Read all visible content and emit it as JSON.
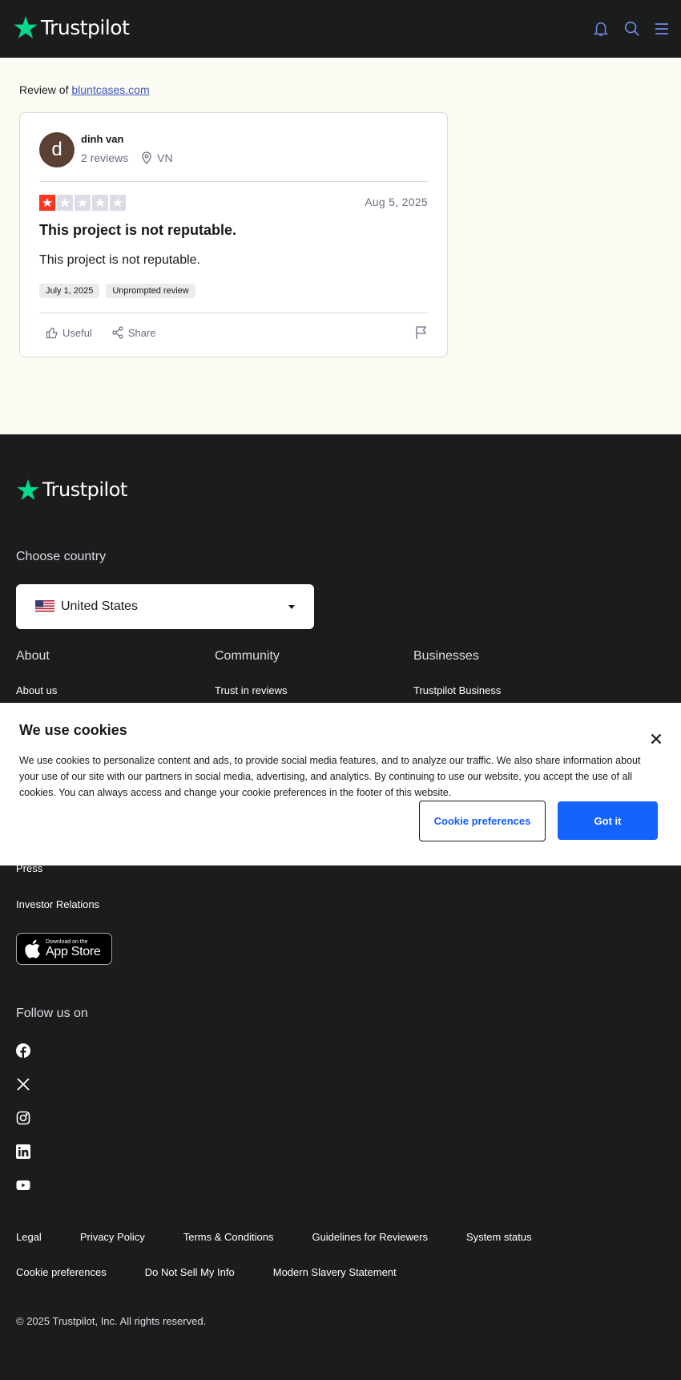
{
  "header": {
    "brand": "Trustpilot",
    "icons": [
      "bell-icon",
      "search-icon",
      "menu-icon"
    ]
  },
  "review_of": {
    "prefix": "Review of",
    "domain": "bluntcases.com"
  },
  "review": {
    "avatar_initial": "d",
    "author": "dinh van",
    "review_count": "2 reviews",
    "location": "VN",
    "rating": 1,
    "max_rating": 5,
    "date": "Aug 5, 2025",
    "title": "This project is not reputable.",
    "body": "This project is not reputable.",
    "experience_date": "July 1, 2025",
    "tag": "Unprompted review",
    "useful_label": "Useful",
    "share_label": "Share"
  },
  "footer": {
    "brand": "Trustpilot",
    "choose_country": "Choose country",
    "country": "United States",
    "columns": [
      {
        "heading": "About",
        "first_link": "About us"
      },
      {
        "heading": "Community",
        "first_link": "Trust in reviews"
      },
      {
        "heading": "Businesses",
        "first_link": "Trustpilot Business"
      }
    ],
    "about_links_more": [
      "Press",
      "Investor Relations"
    ],
    "app_store": {
      "small": "Download on the",
      "big": "App Store"
    },
    "follow_us": "Follow us on",
    "social": [
      "facebook-icon",
      "x-icon",
      "instagram-icon",
      "linkedin-icon",
      "youtube-icon"
    ],
    "legal_row_1": [
      "Legal",
      "Privacy Policy",
      "Terms & Conditions",
      "Guidelines for Reviewers",
      "System status"
    ],
    "legal_row_2": [
      "Cookie preferences",
      "Do Not Sell My Info",
      "Modern Slavery Statement"
    ],
    "copyright": "© 2025 Trustpilot, Inc. All rights reserved."
  },
  "cookie_banner": {
    "title": "We use cookies",
    "text": "We use cookies to personalize content and ads, to provide social media features, and to analyze our traffic. We also share information about your use of our site with our partners in social media, advertising, and analytics. By continuing to use our website, you accept the use of all cookies. You can always access and change your cookie preferences in the footer of this website.",
    "preferences_label": "Cookie preferences",
    "accept_label": "Got it"
  },
  "colors": {
    "brand_green": "#04da8d",
    "star_red": "#ff3722",
    "link_blue": "#3c57bc",
    "button_blue": "#1463fd",
    "dark_bg": "#1c1c1c"
  }
}
